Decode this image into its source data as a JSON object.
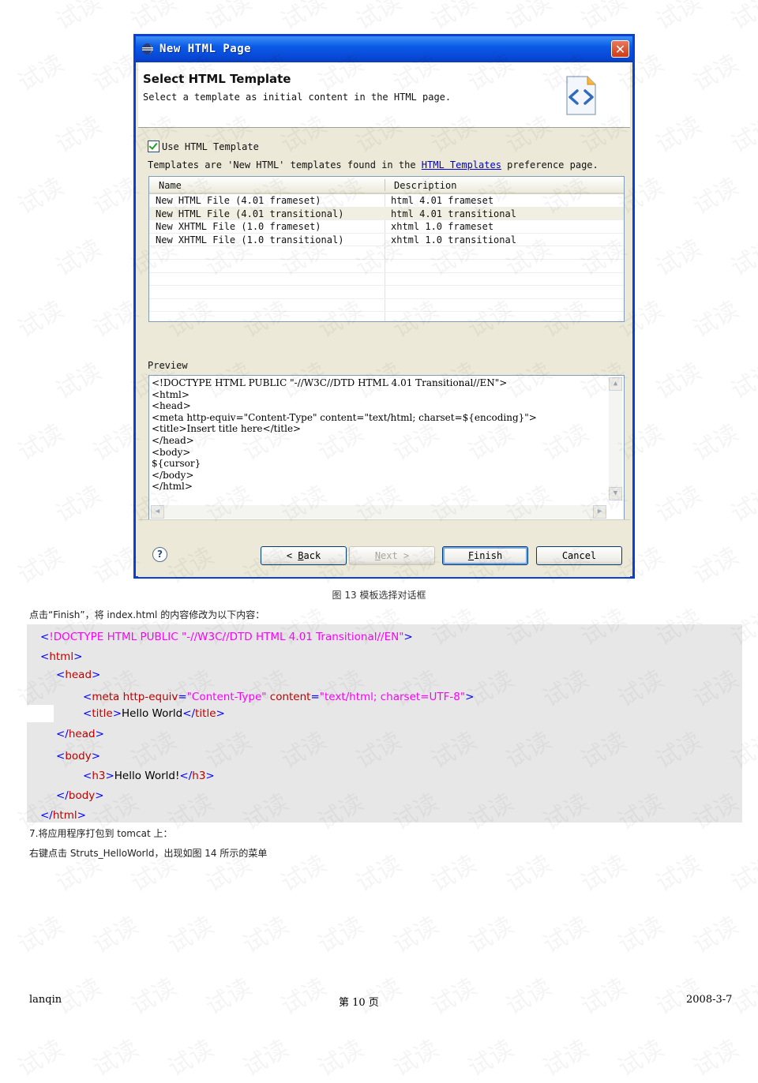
{
  "dialog": {
    "title": "New HTML Page",
    "close_label": "✕",
    "banner_title": "Select HTML Template",
    "banner_desc": "Select a template as initial content in the HTML page.",
    "use_template_label": "Use HTML Template",
    "use_template_checked": true,
    "templates_info_before": "Templates are 'New HTML' templates found in the ",
    "templates_info_link": "HTML Templates",
    "templates_info_after": " preference page.",
    "table": {
      "col_name": "Name",
      "col_desc": "Description",
      "rows": [
        {
          "name": "New HTML File (4.01 frameset)",
          "desc": "html 4.01 frameset"
        },
        {
          "name": "New HTML File (4.01 transitional)",
          "desc": "html 4.01 transitional"
        },
        {
          "name": "New XHTML File (1.0 frameset)",
          "desc": "xhtml 1.0 frameset"
        },
        {
          "name": "New XHTML File (1.0 transitional)",
          "desc": "xhtml 1.0 transitional"
        }
      ],
      "selected_index": 1
    },
    "preview_label": "Preview",
    "preview_code": "<!DOCTYPE HTML PUBLIC \"-//W3C//DTD HTML 4.01 Transitional//EN\">\n<html>\n<head>\n<meta http-equiv=\"Content-Type\" content=\"text/html; charset=${encoding}\">\n<title>Insert title here</title>\n</head>\n<body>\n${cursor}\n</body>\n</html>",
    "buttons": {
      "help": "?",
      "back_prefix": "< ",
      "back_mnemonic": "B",
      "back_rest": "ack",
      "next_mnemonic": "N",
      "next_rest": "ext",
      "next_suffix": " >",
      "finish_mnemonic": "F",
      "finish_rest": "inish",
      "cancel": "Cancel"
    }
  },
  "caption": "图 13 模板选择对话框",
  "para1": "点击“Finish”，将 index.html 的内容修改为以下内容：",
  "code": {
    "l1": {
      "lt": "<",
      "text": "!DOCTYPE HTML PUBLIC \"-//W3C//DTD HTML 4.01 Transitional//EN\"",
      "gt": ">"
    },
    "l2": {
      "lt": "<",
      "tag": "html",
      "gt": ">"
    },
    "l3": {
      "lt": "<",
      "tag": "head",
      "gt": ">"
    },
    "l4": {
      "lt": "<",
      "tag": "meta",
      "attr1": "http-equiv",
      "eq1": "=",
      "val1": "\"Content-Type\"",
      "attr2": "content",
      "eq2": "=",
      "val2": "\"text/html; charset=UTF-8\"",
      "gt": ">"
    },
    "l5": {
      "lt": "<",
      "tag": "title",
      "gt": ">",
      "text": "Hello World",
      "lt2": "</",
      "tag2": "title",
      "gt2": ">"
    },
    "l6": {
      "lt": "</",
      "tag": "head",
      "gt": ">"
    },
    "l7": {
      "lt": "<",
      "tag": "body",
      "gt": ">"
    },
    "l8": {
      "lt": "<",
      "tag": "h3",
      "gt": ">",
      "text": "Hello World!",
      "lt2": "</",
      "tag2": "h3",
      "gt2": ">"
    },
    "l9": {
      "lt": "</",
      "tag": "body",
      "gt": ">"
    },
    "l10": {
      "lt": "</",
      "tag": "html",
      "gt": ">"
    }
  },
  "para2": "7.将应用程序打包到 tomcat 上：",
  "para3": "右键点击 Struts_HelloWorld，出现如图 14 所示的菜单",
  "footer": {
    "author": "lanqin",
    "page": "第 10 页",
    "date": "2008-3-7"
  },
  "watermark": "试读"
}
